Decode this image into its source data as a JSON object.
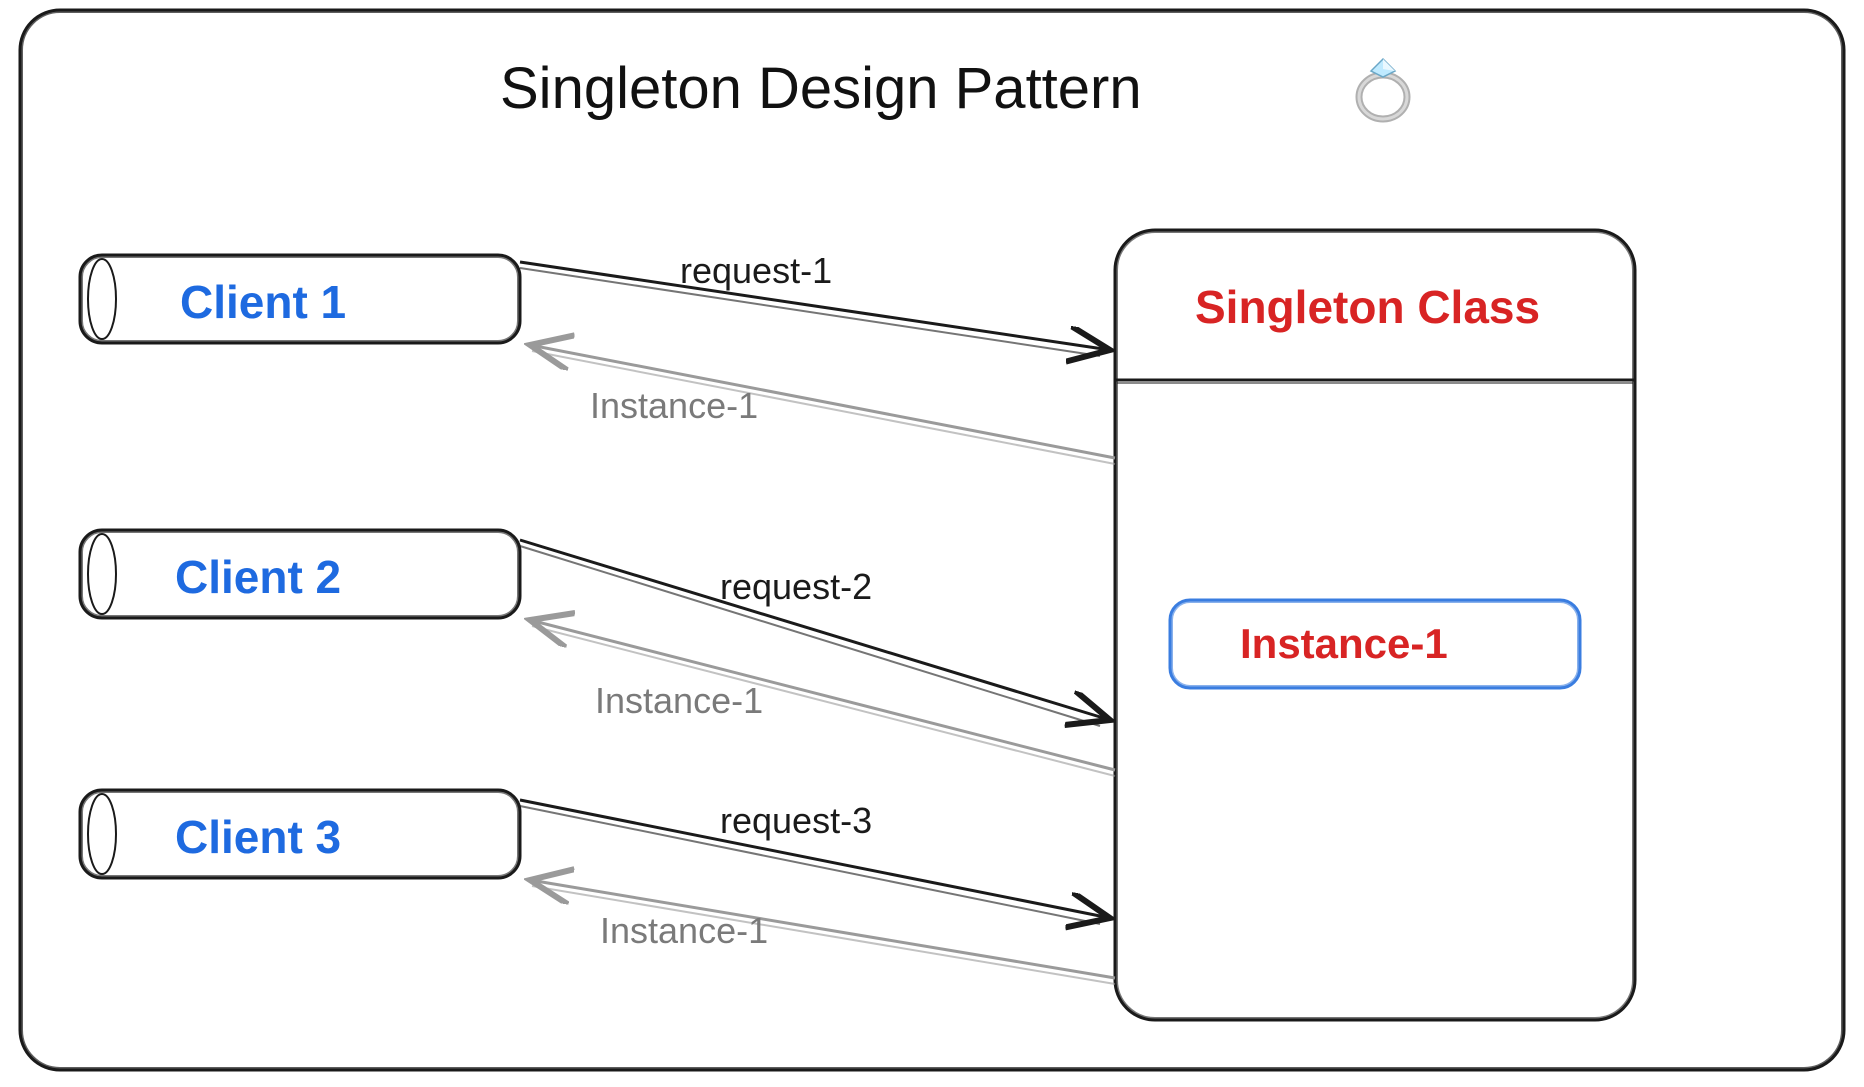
{
  "title": "Singleton Design Pattern",
  "ring_icon": "ring-icon",
  "clients": [
    {
      "label": "Client 1",
      "request": "request-1",
      "response": "Instance-1"
    },
    {
      "label": "Client 2",
      "request": "request-2",
      "response": "Instance-1"
    },
    {
      "label": "Client 3",
      "request": "request-3",
      "response": "Instance-1"
    }
  ],
  "singleton": {
    "title": "Singleton Class",
    "instance_label": "Instance-1"
  },
  "colors": {
    "client": "#1e6ae0",
    "singleton": "#d82424",
    "arrow_req": "#1a1a1a",
    "arrow_resp": "#9a9a9a",
    "box_stroke": "#1a1a1a",
    "instance_box_stroke": "#3a7de0"
  }
}
